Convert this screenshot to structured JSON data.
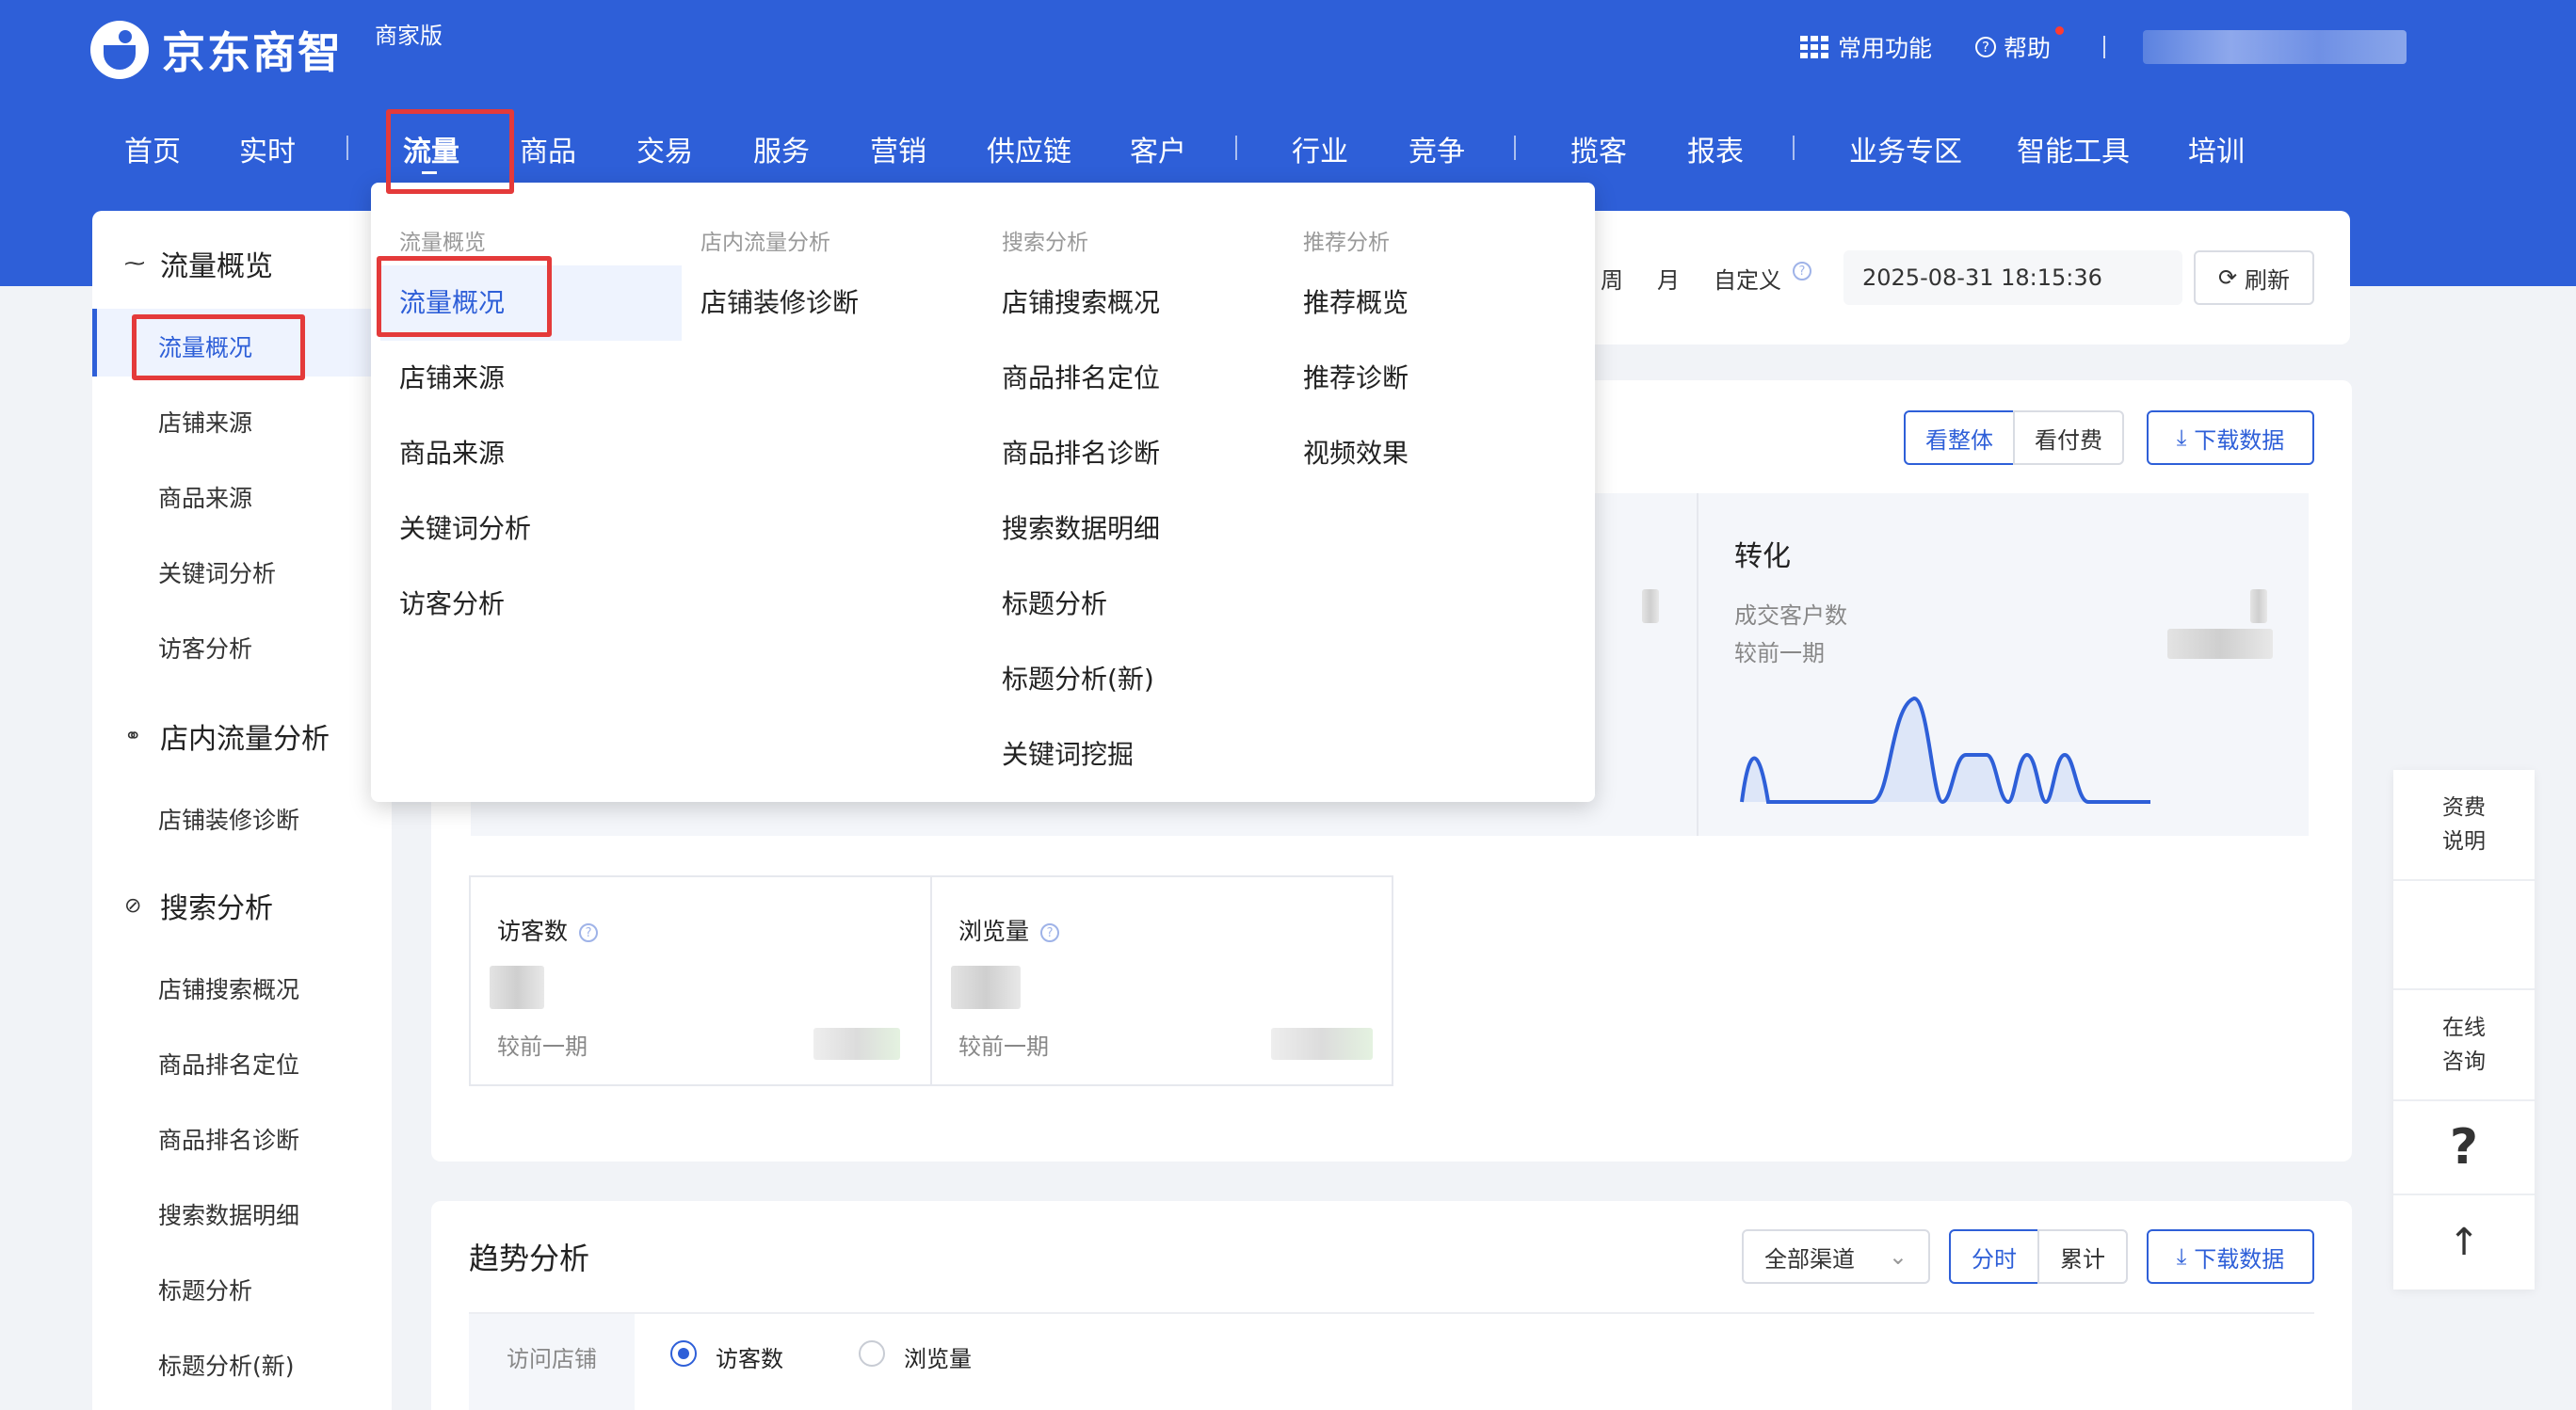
{
  "brand": {
    "name": "京东商智",
    "edition": "商家版"
  },
  "top_right": {
    "common_functions": "常用功能",
    "help": "帮助",
    "separator": "|"
  },
  "nav": {
    "items": [
      "首页",
      "实时",
      "流量",
      "商品",
      "交易",
      "服务",
      "营销",
      "供应链",
      "客户",
      "行业",
      "竞争",
      "揽客",
      "报表",
      "业务专区",
      "智能工具",
      "培训"
    ],
    "separator": "|",
    "active": "流量"
  },
  "sidebar": {
    "groups": [
      {
        "label": "流量概览",
        "icon": "pulse-icon",
        "items": [
          "流量概况",
          "店铺来源",
          "商品来源",
          "关键词分析",
          "访客分析"
        ]
      },
      {
        "label": "店内流量分析",
        "icon": "flow-icon",
        "items": [
          "店铺装修诊断"
        ]
      },
      {
        "label": "搜索分析",
        "icon": "search-analysis-icon",
        "items": [
          "店铺搜索概况",
          "商品排名定位",
          "商品排名诊断",
          "搜索数据明细",
          "标题分析",
          "标题分析(新)"
        ]
      }
    ],
    "active_item": "流量概况"
  },
  "toolbar": {
    "time_options": [
      "周",
      "月",
      "自定义"
    ],
    "datetime": "2025-08-31 18:15:36",
    "refresh": "刷新"
  },
  "overview": {
    "view_buttons": [
      "看整体",
      "看付费"
    ],
    "download": "下载数据",
    "conversion": {
      "title": "转化",
      "metric": "成交客户数",
      "compare": "较前一期"
    }
  },
  "stats": [
    {
      "label": "访客数",
      "compare": "较前一期"
    },
    {
      "label": "浏览量",
      "compare": "较前一期"
    }
  ],
  "trend": {
    "title": "趋势分析",
    "channel_select": "全部渠道",
    "mode_buttons": [
      "分时",
      "累计"
    ],
    "download": "下载数据",
    "row_label": "访问店铺",
    "radios": [
      "访客数",
      "浏览量"
    ]
  },
  "dropdown": {
    "columns": [
      {
        "title": "流量概览",
        "items": [
          "流量概况",
          "店铺来源",
          "商品来源",
          "关键词分析",
          "访客分析"
        ]
      },
      {
        "title": "店内流量分析",
        "items": [
          "店铺装修诊断"
        ]
      },
      {
        "title": "搜索分析",
        "items": [
          "店铺搜索概况",
          "商品排名定位",
          "商品排名诊断",
          "搜索数据明细",
          "标题分析",
          "标题分析(新)",
          "关键词挖掘"
        ]
      },
      {
        "title": "推荐分析",
        "items": [
          "推荐概览",
          "推荐诊断",
          "视频效果"
        ]
      }
    ]
  },
  "right_rail": {
    "fees": "资费说明",
    "consult": "在线咨询",
    "question": "?",
    "to_top": "↑"
  },
  "colors": {
    "primary": "#2e5fd8",
    "highlight": "#e43a3a"
  }
}
